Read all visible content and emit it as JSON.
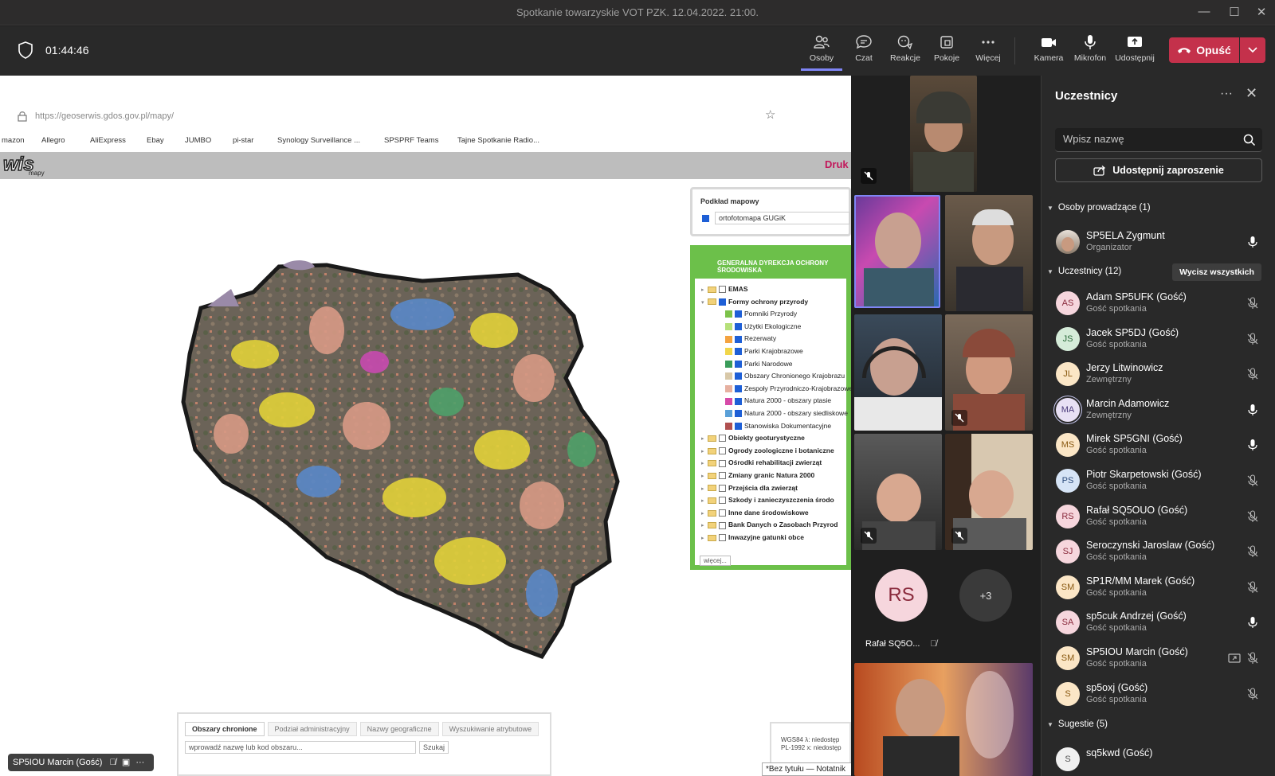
{
  "window": {
    "title": "Spotkanie towarzyskie VOT PZK. 12.04.2022. 21:00."
  },
  "toolbar": {
    "timer": "01:44:46",
    "buttons": [
      {
        "label": "Osoby",
        "icon": "people-icon"
      },
      {
        "label": "Czat",
        "icon": "chat-icon"
      },
      {
        "label": "Reakcje",
        "icon": "reactions-icon"
      },
      {
        "label": "Pokoje",
        "icon": "rooms-icon"
      },
      {
        "label": "Więcej",
        "icon": "more-icon"
      },
      {
        "label": "Kamera",
        "icon": "camera-icon"
      },
      {
        "label": "Mikrofon",
        "icon": "microphone-icon"
      },
      {
        "label": "Udostępnij",
        "icon": "share-icon"
      }
    ],
    "leave_label": "Opuść"
  },
  "shared_screen": {
    "url": "https://geoserwis.gdos.gov.pl/mapy/",
    "bookmarks": [
      "mazon",
      "Allegro",
      "AliExpress",
      "Ebay",
      "JUMBO",
      "pi-star",
      "Synology Surveillance ...",
      "SPSPRF Teams",
      "Tajne Spotkanie Radio..."
    ],
    "logo": "wis",
    "logo_sub": "mapy",
    "druk": "Druk",
    "podklad_title": "Podkład mapowy",
    "podklad_value": "ortofotomapa GUGiK",
    "legend_header": "GENERALNA DYREKCJA OCHRONY ŚRODOWISKA",
    "legend_items": [
      {
        "label": "EMAS",
        "checked": false,
        "level": 0
      },
      {
        "label": "Formy ochrony przyrody",
        "checked": true,
        "level": 0
      },
      {
        "label": "Pomniki Przyrody",
        "checked": true,
        "level": 1,
        "color": "#7cc24a"
      },
      {
        "label": "Użytki Ekologiczne",
        "checked": true,
        "level": 1,
        "color": "#b6e07a"
      },
      {
        "label": "Rezerwaty",
        "checked": true,
        "level": 1,
        "color": "#f4a340"
      },
      {
        "label": "Parki Krajobrazowe",
        "checked": true,
        "level": 1,
        "color": "#f1d64a"
      },
      {
        "label": "Parki Narodowe",
        "checked": true,
        "level": 1,
        "color": "#3a9c5a"
      },
      {
        "label": "Obszary Chronionego Krajobrazu",
        "checked": true,
        "level": 1,
        "color": "#d8c8a8"
      },
      {
        "label": "Zespoły Przyrodniczo-Krajobrazowe",
        "checked": true,
        "level": 1,
        "color": "#e6b0a0"
      },
      {
        "label": "Natura 2000 - obszary ptasie",
        "checked": true,
        "level": 1,
        "color": "#d64aa8"
      },
      {
        "label": "Natura 2000 - obszary siedliskowe",
        "checked": true,
        "level": 1,
        "color": "#5aa0d8"
      },
      {
        "label": "Stanowiska Dokumentacyjne",
        "checked": true,
        "level": 1,
        "color": "#b05050"
      },
      {
        "label": "Obiekty geoturystyczne",
        "checked": false,
        "level": 0
      },
      {
        "label": "Ogrody zoologiczne i botaniczne",
        "checked": false,
        "level": 0
      },
      {
        "label": "Ośrodki rehabilitacji zwierząt",
        "checked": false,
        "level": 0
      },
      {
        "label": "Zmiany granic Natura 2000",
        "checked": false,
        "level": 0
      },
      {
        "label": "Przejścia dla zwierząt",
        "checked": false,
        "level": 0
      },
      {
        "label": "Szkody i zanieczyszczenia środo",
        "checked": false,
        "level": 0
      },
      {
        "label": "Inne dane środowiskowe",
        "checked": false,
        "level": 0
      },
      {
        "label": "Bank Danych o Zasobach Przyrod",
        "checked": false,
        "level": 0
      },
      {
        "label": "Inwazyjne gatunki obce",
        "checked": false,
        "level": 0
      }
    ],
    "legend_more": "więcej...",
    "search_tabs": [
      "Obszary chronione",
      "Podział administracyjny",
      "Nazwy geograficzne",
      "Wyszukiwanie atrybutowe"
    ],
    "search_placeholder": "wprowadź nazwę lub kod obszaru...",
    "search_button": "Szukaj",
    "coords": [
      "WGS84  λ: niedostęp",
      "PL-1992  x: niedostęp"
    ],
    "notepad": "*Bez tytułu — Notatnik",
    "presenter_label": "SP5IOU Marcin (Gość)"
  },
  "video_tiles": {
    "rs_initials": "RS",
    "rs_name": "Rafał SQ5O...",
    "overflow": "+3"
  },
  "panel": {
    "title": "Uczestnicy",
    "search_placeholder": "Wpisz nazwę",
    "invite_label": "Udostępnij zaproszenie",
    "organizers_section": "Osoby prowadzące (1)",
    "organizer": {
      "name": "SP5ELA Zygmunt",
      "role": "Organizator"
    },
    "participants_section": "Uczestnicy (12)",
    "mute_all": "Wycisz wszystkich",
    "participants": [
      {
        "initials": "AS",
        "name": "Adam SP5UFK (Gość)",
        "role": "Gość spotkania",
        "mic": "off",
        "bg": "#f6d6dd",
        "fg": "#8a2b3d"
      },
      {
        "initials": "JS",
        "name": "Jacek SP5DJ (Gość)",
        "role": "Gość spotkania",
        "mic": "off",
        "bg": "#d5ecd9",
        "fg": "#2b6a3a"
      },
      {
        "initials": "JL",
        "name": "Jerzy Litwinowicz",
        "role": "Zewnętrzny",
        "mic": "off",
        "bg": "#fbe6c6",
        "fg": "#8a5a12"
      },
      {
        "initials": "MA",
        "name": "Marcin Adamowicz",
        "role": "Zewnętrzny",
        "mic": "on",
        "bg": "#e8e0f4",
        "fg": "#4a3a7a"
      },
      {
        "initials": "MS",
        "name": "Mirek SP5GNI (Gość)",
        "role": "Gość spotkania",
        "mic": "on",
        "bg": "#fbe6c6",
        "fg": "#8a5a12"
      },
      {
        "initials": "PS",
        "name": "Piotr Skarpetowski (Gość)",
        "role": "Gość spotkania",
        "mic": "off",
        "bg": "#d6e4f6",
        "fg": "#2b4a7a"
      },
      {
        "initials": "RS",
        "name": "Rafał SQ5OUO (Gość)",
        "role": "Gość spotkania",
        "mic": "off",
        "bg": "#f6d6dd",
        "fg": "#8a2b3d"
      },
      {
        "initials": "SJ",
        "name": "Seroczynski Jaroslaw (Gość)",
        "role": "Gość spotkania",
        "mic": "off",
        "bg": "#f6d6dd",
        "fg": "#8a2b3d"
      },
      {
        "initials": "SM",
        "name": "SP1R/MM Marek (Gość)",
        "role": "Gość spotkania",
        "mic": "off",
        "bg": "#fbe6c6",
        "fg": "#8a5a12"
      },
      {
        "initials": "SA",
        "name": "sp5cuk Andrzej (Gość)",
        "role": "Gość spotkania",
        "mic": "on",
        "bg": "#f6d6dd",
        "fg": "#8a2b3d"
      },
      {
        "initials": "SM",
        "name": "SP5IOU Marcin (Gość)",
        "role": "Gość spotkania",
        "mic": "off",
        "bg": "#fbe6c6",
        "fg": "#8a5a12"
      },
      {
        "initials": "S",
        "name": "sp5oxj (Gość)",
        "role": "Gość spotkania",
        "mic": "off",
        "bg": "#fbe6c6",
        "fg": "#8a5a12"
      }
    ],
    "suggestions_section": "Sugestie (5)",
    "suggestion": {
      "initials": "S",
      "name": "sq5kwd (Gość)"
    }
  }
}
